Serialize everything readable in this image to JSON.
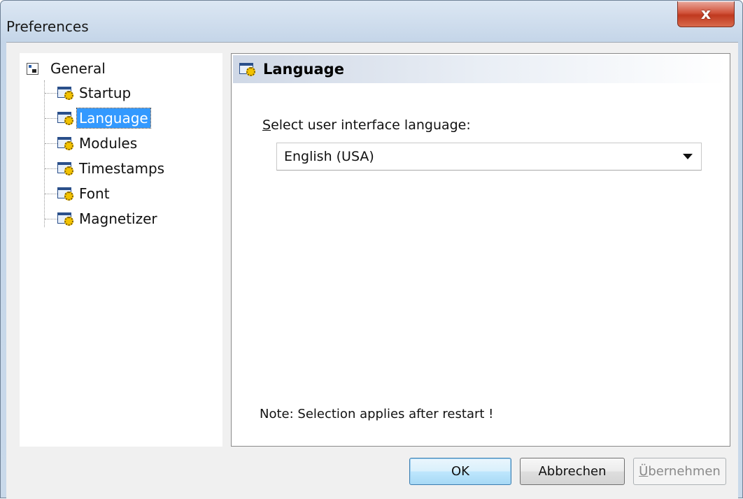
{
  "window": {
    "title": "Preferences",
    "close_glyph": "x"
  },
  "tree": {
    "root": {
      "label": "General",
      "icon": "tree-root-icon"
    },
    "items": [
      {
        "label": "Startup",
        "icon": "settings-page-icon",
        "selected": false
      },
      {
        "label": "Language",
        "icon": "settings-page-icon",
        "selected": true
      },
      {
        "label": "Modules",
        "icon": "settings-page-icon",
        "selected": false
      },
      {
        "label": "Timestamps",
        "icon": "settings-page-icon",
        "selected": false
      },
      {
        "label": "Font",
        "icon": "settings-page-icon",
        "selected": false
      },
      {
        "label": "Magnetizer",
        "icon": "settings-page-icon",
        "selected": false
      }
    ]
  },
  "panel": {
    "title": "Language",
    "field_label_accel": "S",
    "field_label_rest": "elect user interface language:",
    "language_value": "English (USA)",
    "note": "Note: Selection applies after restart !"
  },
  "buttons": {
    "ok": "OK",
    "cancel": "Abbrechen",
    "apply_accel": "Ü",
    "apply_rest": "bernehmen"
  },
  "colors": {
    "selection": "#3399ff",
    "close_button": "#c7432a"
  }
}
